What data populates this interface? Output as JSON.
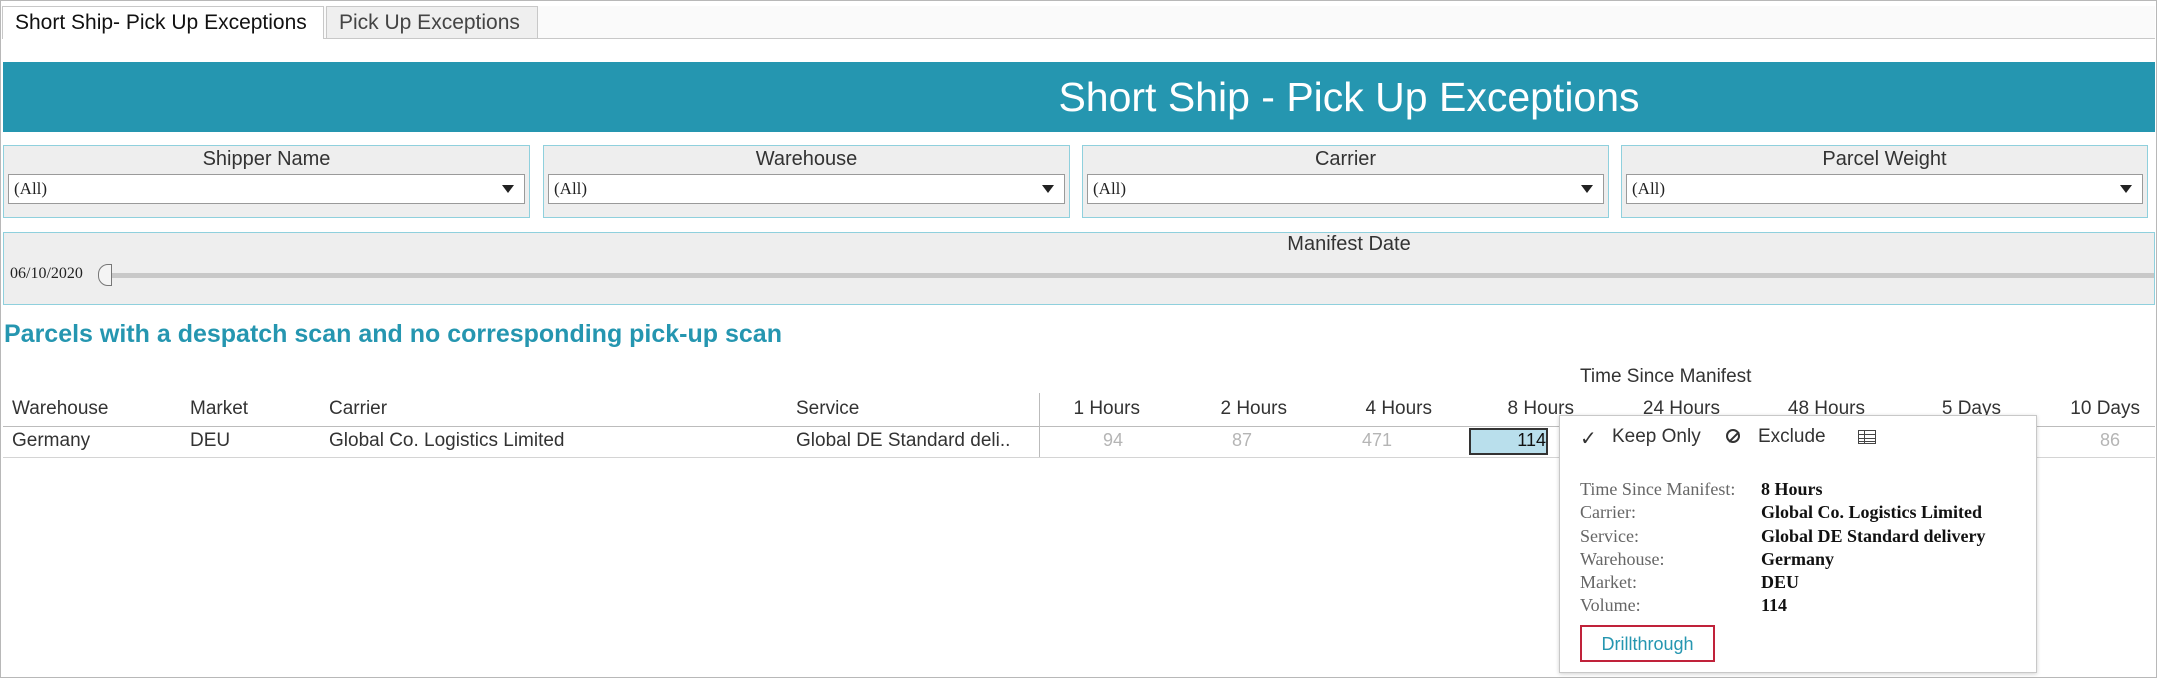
{
  "tabs": [
    {
      "label": "Short Ship- Pick Up Exceptions",
      "active": true
    },
    {
      "label": "Pick Up Exceptions",
      "active": false
    }
  ],
  "banner": {
    "title": "Short Ship - Pick Up Exceptions",
    "color": "#2596b0"
  },
  "filters": [
    {
      "label": "Shipper Name",
      "value": "(All)"
    },
    {
      "label": "Warehouse",
      "value": "(All)"
    },
    {
      "label": "Carrier",
      "value": "(All)"
    },
    {
      "label": "Parcel Weight",
      "value": "(All)"
    }
  ],
  "manifest_date": {
    "label": "Manifest Date",
    "value": "06/10/2020"
  },
  "section": {
    "title": "Parcels with a despatch scan and no corresponding pick-up scan"
  },
  "table": {
    "group_header": "Time Since Manifest",
    "columns": [
      "Warehouse",
      "Market",
      "Carrier",
      "Service"
    ],
    "time_columns": [
      "1 Hours",
      "2 Hours",
      "4 Hours",
      "8 Hours",
      "24 Hours",
      "48 Hours",
      "5 Days",
      "10 Days"
    ],
    "row": {
      "warehouse": "Germany",
      "market": "DEU",
      "carrier": "Global Co. Logistics Limited",
      "service": "Global DE Standard deli..",
      "values": [
        "94",
        "87",
        "471",
        "114",
        "",
        "",
        "",
        "86"
      ]
    }
  },
  "tooltip": {
    "actions": {
      "keep_only": "Keep Only",
      "exclude": "Exclude"
    },
    "fields": [
      {
        "key": "Time Since Manifest:",
        "value": "8 Hours"
      },
      {
        "key": "Carrier:",
        "value": "Global Co. Logistics Limited"
      },
      {
        "key": "Service:",
        "value": "Global DE Standard delivery"
      },
      {
        "key": "Warehouse:",
        "value": "Germany"
      },
      {
        "key": "Market:",
        "value": "DEU"
      },
      {
        "key": "Volume:",
        "value": "114"
      }
    ],
    "drillthrough": "Drillthrough"
  }
}
